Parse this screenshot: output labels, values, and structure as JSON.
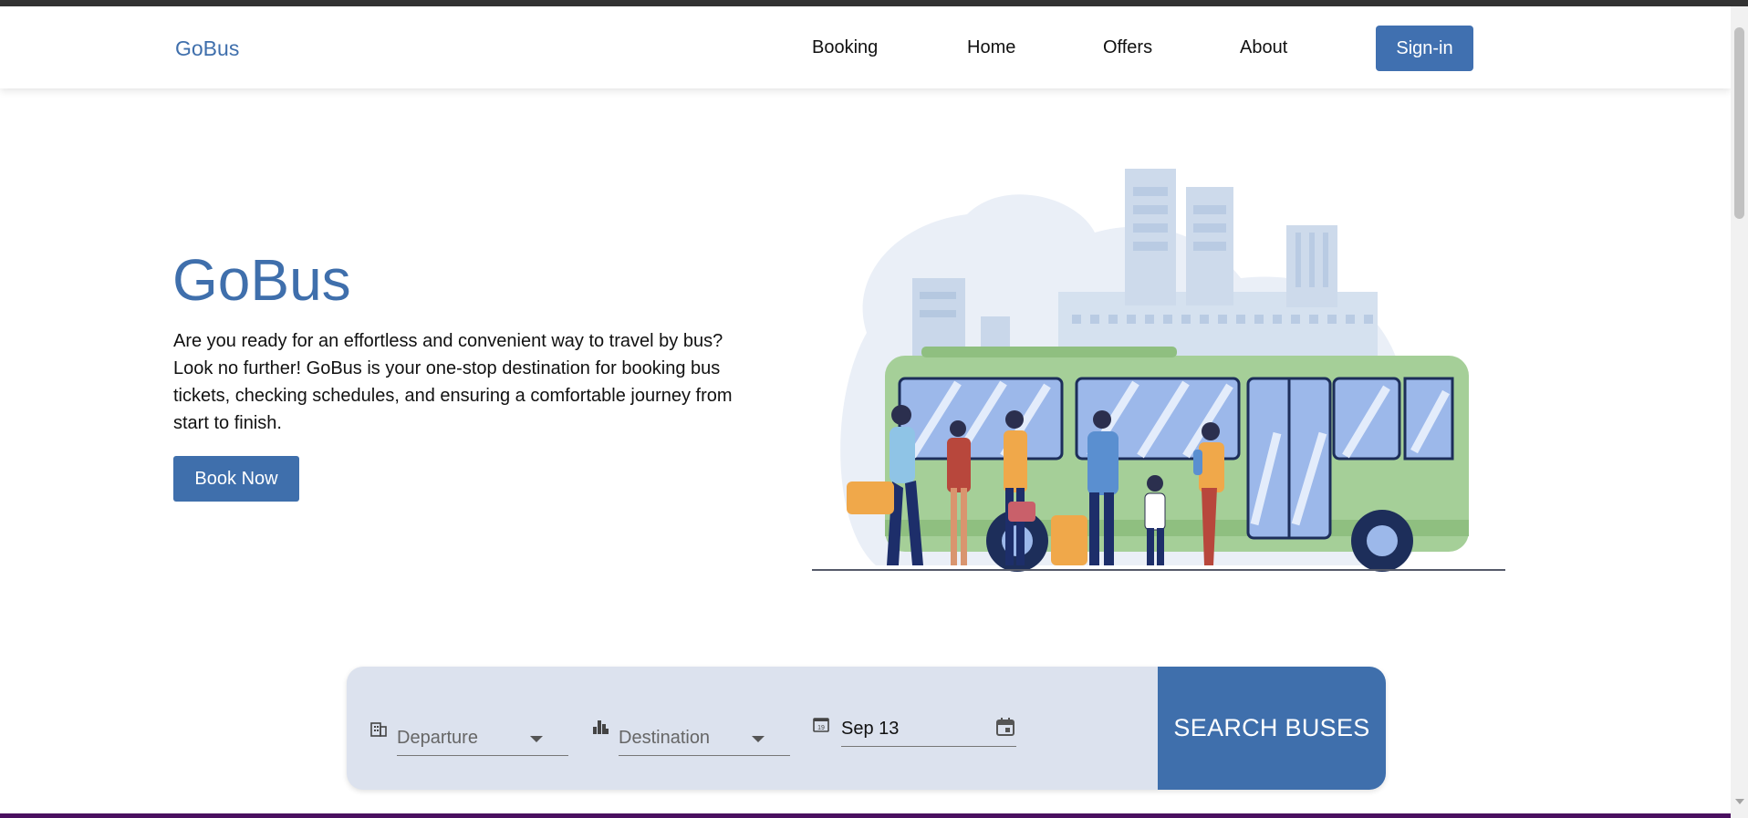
{
  "nav": {
    "brand": "GoBus",
    "links": [
      "Booking",
      "Home",
      "Offers",
      "About"
    ],
    "signin_label": "Sign-in"
  },
  "hero": {
    "title": "GoBus",
    "text": "Are you ready for an effortless and convenient way to travel by bus? Look no further! GoBus is your one-stop destination for booking bus tickets, checking schedules, and ensuring a comfortable journey from start to finish.",
    "button_label": "Book Now"
  },
  "search": {
    "departure_placeholder": "Departure",
    "destination_placeholder": "Destination",
    "date_value": "Sep 13",
    "date_icon_day": "19",
    "button_label": "SEARCH BUSES"
  },
  "colors": {
    "primary": "#3f6fac",
    "panel": "#dce2ee",
    "bus_green": "#a5cf98"
  }
}
